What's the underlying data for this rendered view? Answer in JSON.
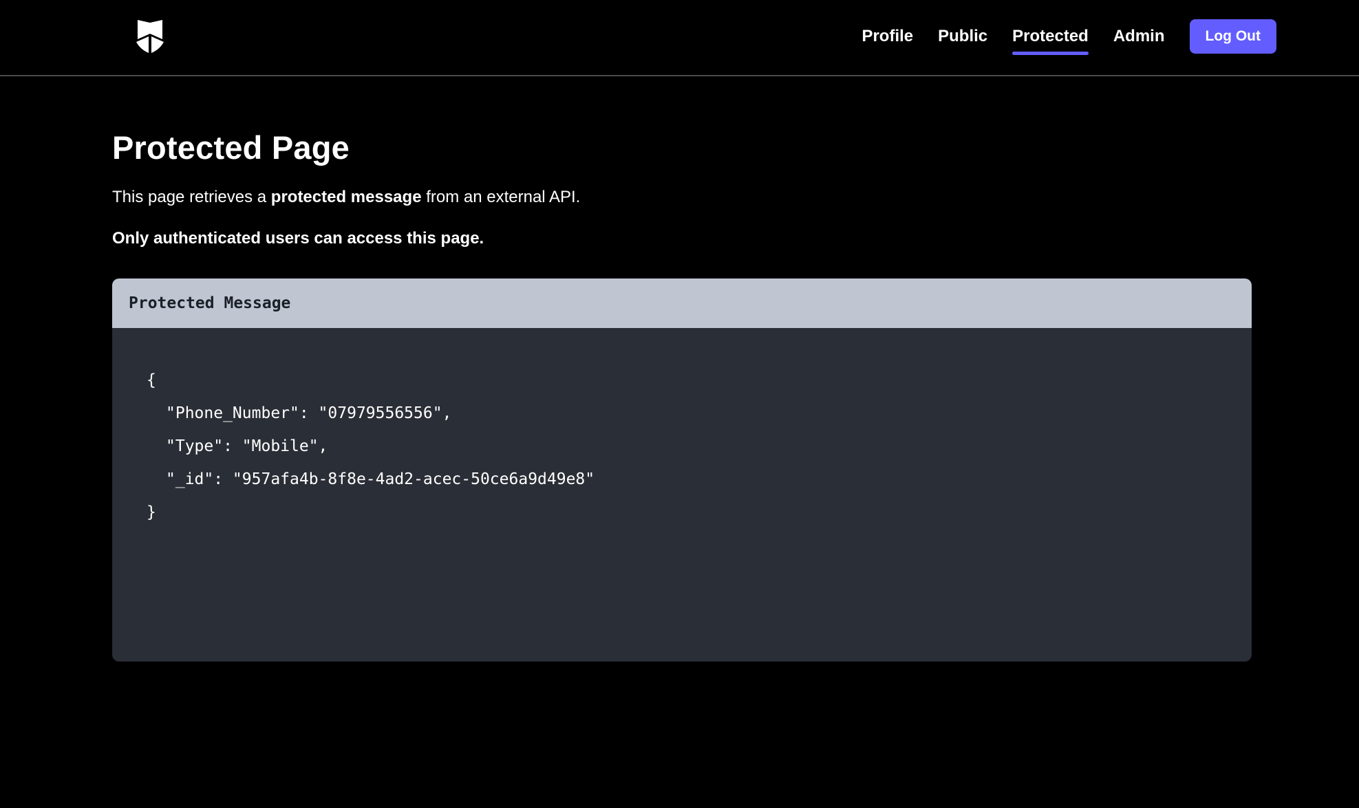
{
  "header": {
    "logo_icon": "shield-logo-icon",
    "nav_items": [
      {
        "label": "Profile",
        "active": false
      },
      {
        "label": "Public",
        "active": false
      },
      {
        "label": "Protected",
        "active": true
      },
      {
        "label": "Admin",
        "active": false
      }
    ],
    "logout_label": "Log Out",
    "accent_color": "#635dff"
  },
  "page": {
    "title": "Protected Page",
    "description_pre": "This page retrieves a ",
    "description_bold": "protected message",
    "description_post": " from an external API.",
    "notice": "Only authenticated users can access this page."
  },
  "code_box": {
    "title": "Protected Message",
    "open_brace": "{",
    "lines": [
      "\"Phone_Number\": \"07979556556\",",
      "\"Type\": \"Mobile\",",
      "\"_id\": \"957afa4b-8f8e-4ad2-acec-50ce6a9d49e8\""
    ],
    "close_brace": "}"
  }
}
